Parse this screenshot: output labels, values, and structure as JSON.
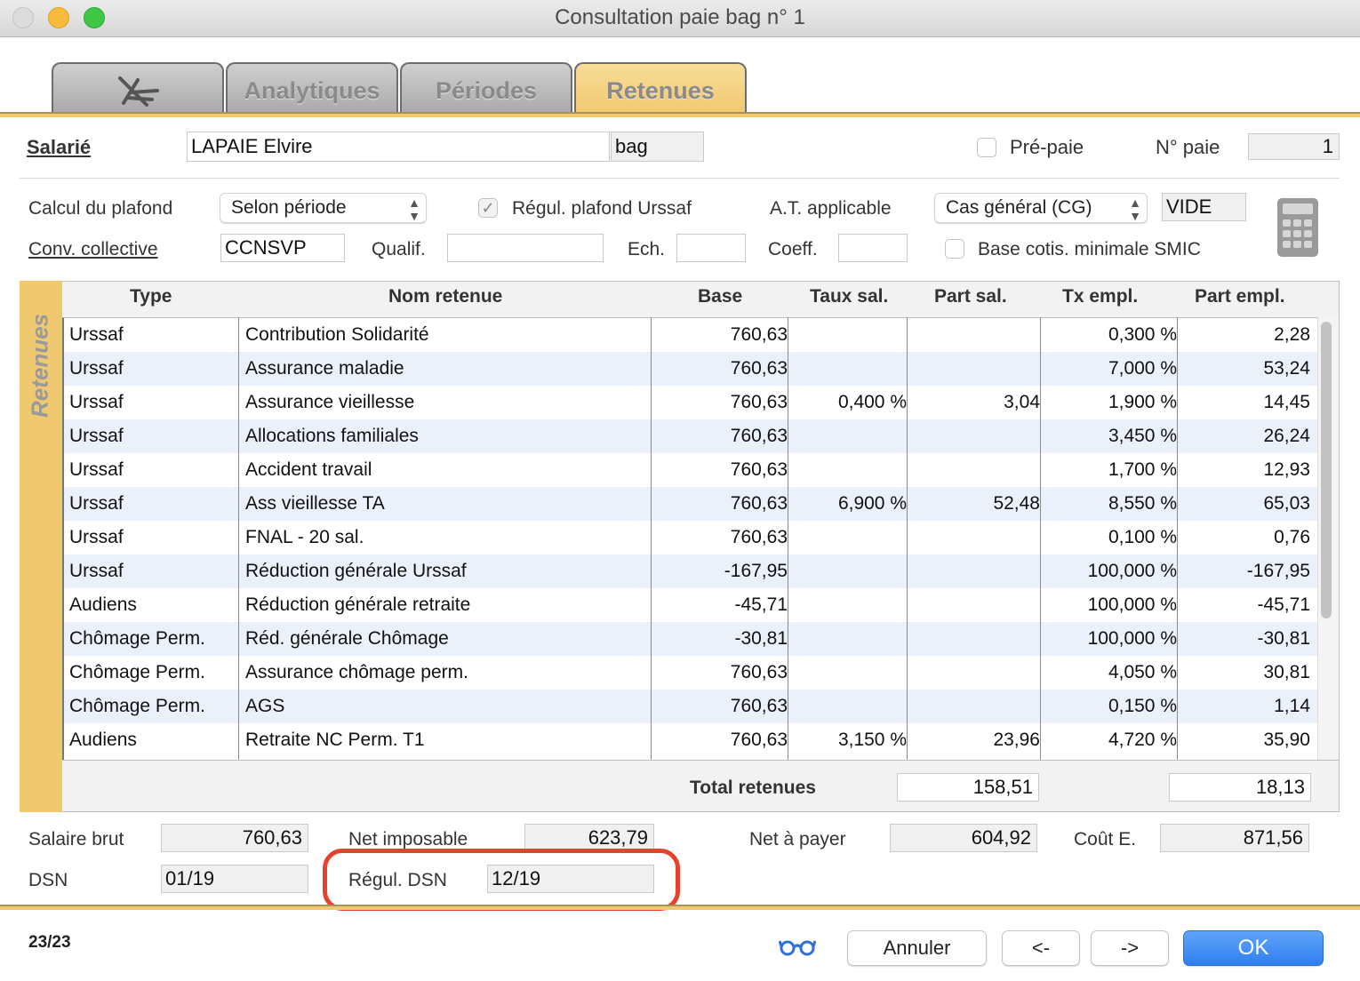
{
  "window": {
    "title": "Consultation paie bag n° 1"
  },
  "tabs": [
    {
      "label": ""
    },
    {
      "label": "Analytiques"
    },
    {
      "label": "Périodes"
    },
    {
      "label": "Retenues"
    }
  ],
  "header": {
    "salarie_label": "Salarié",
    "salarie_value": "LAPAIE Elvire",
    "code_value": "bag",
    "prepaie_label": "Pré-paie",
    "npaie_label": "N° paie",
    "npaie_value": "1",
    "calcul_label": "Calcul du plafond",
    "calcul_value": "Selon période",
    "regul_plafond_label": "Régul. plafond Urssaf",
    "at_label": "A.T. applicable",
    "at_value": "Cas général (CG)",
    "at_code": "VIDE",
    "conv_label": "Conv. collective",
    "conv_value": "CCNSVP",
    "qualif_label": "Qualif.",
    "qualif_value": "",
    "ech_label": "Ech.",
    "ech_value": "",
    "coeff_label": "Coeff.",
    "coeff_value": "",
    "base_smic_label": "Base cotis. minimale SMIC"
  },
  "table": {
    "side_label": "Retenues",
    "columns": [
      "Type",
      "Nom retenue",
      "Base",
      "Taux sal.",
      "Part sal.",
      "Tx empl.",
      "Part empl."
    ],
    "rows": [
      [
        "Urssaf",
        "Contribution Solidarité",
        "760,63",
        "",
        "",
        "0,300 %",
        "2,28"
      ],
      [
        "Urssaf",
        "Assurance maladie",
        "760,63",
        "",
        "",
        "7,000 %",
        "53,24"
      ],
      [
        "Urssaf",
        "Assurance vieillesse",
        "760,63",
        "0,400 %",
        "3,04",
        "1,900 %",
        "14,45"
      ],
      [
        "Urssaf",
        "Allocations familiales",
        "760,63",
        "",
        "",
        "3,450 %",
        "26,24"
      ],
      [
        "Urssaf",
        "Accident travail",
        "760,63",
        "",
        "",
        "1,700 %",
        "12,93"
      ],
      [
        "Urssaf",
        "Ass vieillesse TA",
        "760,63",
        "6,900 %",
        "52,48",
        "8,550 %",
        "65,03"
      ],
      [
        "Urssaf",
        "FNAL - 20 sal.",
        "760,63",
        "",
        "",
        "0,100 %",
        "0,76"
      ],
      [
        "Urssaf",
        "Réduction générale Urssaf",
        "-167,95",
        "",
        "",
        "100,000 %",
        "-167,95"
      ],
      [
        "Audiens",
        "Réduction générale retraite",
        "-45,71",
        "",
        "",
        "100,000 %",
        "-45,71"
      ],
      [
        "Chômage Perm.",
        "Réd. générale Chômage",
        "-30,81",
        "",
        "",
        "100,000 %",
        "-30,81"
      ],
      [
        "Chômage Perm.",
        "Assurance chômage perm.",
        "760,63",
        "",
        "",
        "4,050 %",
        "30,81"
      ],
      [
        "Chômage Perm.",
        "AGS",
        "760,63",
        "",
        "",
        "0,150 %",
        "1,14"
      ],
      [
        "Audiens",
        "Retraite NC Perm. T1",
        "760,63",
        "3,150 %",
        "23,96",
        "4,720 %",
        "35,90"
      ]
    ],
    "total_label": "Total retenues",
    "total_sal": "158,51",
    "total_empl": "18,13"
  },
  "summary": {
    "brut_label": "Salaire brut",
    "brut_value": "760,63",
    "imposable_label": "Net imposable",
    "imposable_value": "623,79",
    "net_label": "Net à payer",
    "net_value": "604,92",
    "cout_label": "Coût E.",
    "cout_value": "871,56",
    "dsn_label": "DSN",
    "dsn_value": "01/19",
    "regul_dsn_label": "Régul. DSN",
    "regul_dsn_value": "12/19"
  },
  "footer": {
    "counter": "23/23",
    "cancel": "Annuler",
    "prev": "<-",
    "next": "->",
    "ok": "OK"
  },
  "colors": {
    "accent": "#f0c870",
    "row_alt": "#ebf1fb",
    "ok_button": "#2f7ff0",
    "highlight": "#e5432e"
  }
}
